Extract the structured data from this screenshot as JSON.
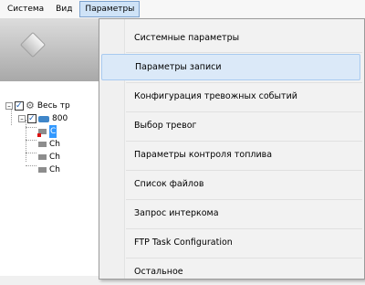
{
  "menubar": {
    "items": [
      {
        "label": "Система"
      },
      {
        "label": "Вид"
      },
      {
        "label": "Параметры",
        "active": true
      }
    ]
  },
  "tree": {
    "root_label": "Весь тр",
    "device_label": "800",
    "channels": [
      "C",
      "Ch",
      "Ch",
      "Ch"
    ]
  },
  "dropdown": {
    "items": [
      {
        "label": "Системные параметры"
      },
      {
        "label": "Параметры записи",
        "highlighted": true
      },
      {
        "label": "Конфигурация тревожных событий"
      },
      {
        "label": "Выбор тревог"
      },
      {
        "label": "Параметры контроля топлива"
      },
      {
        "label": "Список файлов"
      },
      {
        "label": "Запрос интеркома"
      },
      {
        "label": "FTP Task Configuration"
      },
      {
        "label": "Остальное"
      }
    ]
  },
  "colors": {
    "selection": "#3399ff",
    "menu_hover": "#dbe9f8",
    "active_menu": "#cfe3f7"
  }
}
